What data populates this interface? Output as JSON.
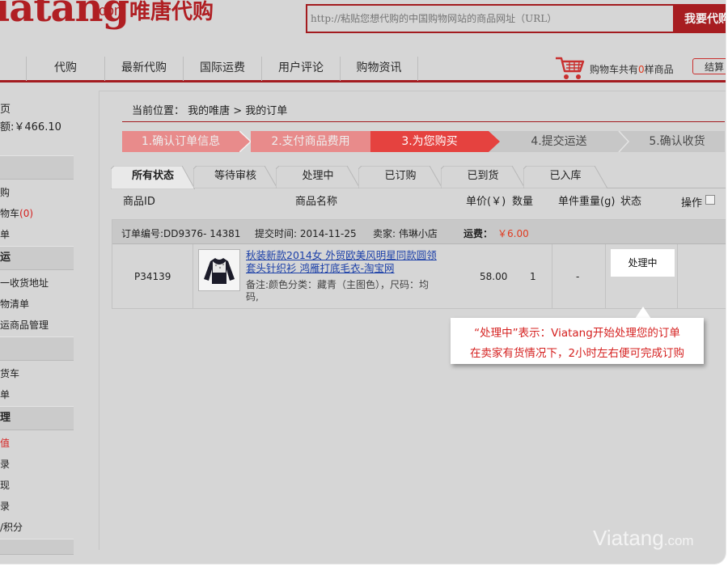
{
  "header": {
    "logo_text": "iatang",
    "logo_com": ".com",
    "logo_cn": "唯唐代购",
    "search_placeholder": "http://粘贴您想代购的中国购物网站的商品网址（URL）",
    "search_button": "我要代购"
  },
  "nav": {
    "items": [
      "代购",
      "最新代购",
      "国际运费",
      "用户评论",
      "购物资讯"
    ],
    "cart_prefix": "购物车共有",
    "cart_count": "0",
    "cart_suffix": "样商品",
    "checkout": "结算"
  },
  "sidebar": {
    "line1": "页",
    "line2": "额:￥466.10",
    "group1": "",
    "g1_items": [
      "购",
      "物车",
      "单"
    ],
    "g1_cart_count": "(0)",
    "group2": "运",
    "g2_items": [
      "一收货地址",
      "物清单",
      "运商品管理"
    ],
    "group3": "",
    "g3_items": [
      "货车",
      "单"
    ],
    "group4": "理",
    "g4_items": [
      "值",
      "录",
      "现",
      "录",
      "/积分"
    ]
  },
  "main": {
    "breadcrumb": "当前位置：  我的唯唐  >  我的订单",
    "steps": [
      "1.确认订单信息",
      "2.支付商品费用",
      "3.为您购买",
      "4.提交运送",
      "5.确认收货"
    ],
    "tabs": [
      "所有状态",
      "等待审核",
      "处理中",
      "已订购",
      "已到货",
      "已入库"
    ],
    "table_headers": {
      "product_id": "商品ID",
      "product_name": "商品名称",
      "price": "单价(￥)",
      "qty": "数量",
      "weight": "单件重量(g)",
      "status": "状态",
      "action": "操作"
    }
  },
  "order": {
    "number_label": "订单编号:DD9376- 14381",
    "submit_time": "提交时间: 2014-11-25",
    "seller": "卖家:   伟琳小店",
    "shipping_label": "运费：",
    "shipping_value": "￥6.00",
    "product_id": "P34139",
    "product_title": "秋装新款2014女 外贸欧美风明星同款圆领套头针织衫 鸿雁打底毛衣-淘宝网",
    "product_note": "备注:颜色分类：藏青（主图色），尺码：均码,",
    "price": "58.00",
    "qty": "1",
    "weight": "-",
    "status": "处理中"
  },
  "tooltip": {
    "line1": "“处理中”表示：Viatang开始处理您的订单",
    "line2": "在卖家有货情况下，2小时左右便可完成订购"
  },
  "watermark": {
    "brand": "Viatang",
    "tld": ".com"
  },
  "colors": {
    "brand_red": "#a31b1f",
    "step_active": "#e5423f",
    "step_done": "#e88b8b",
    "step_todo": "#c7c7c7"
  }
}
